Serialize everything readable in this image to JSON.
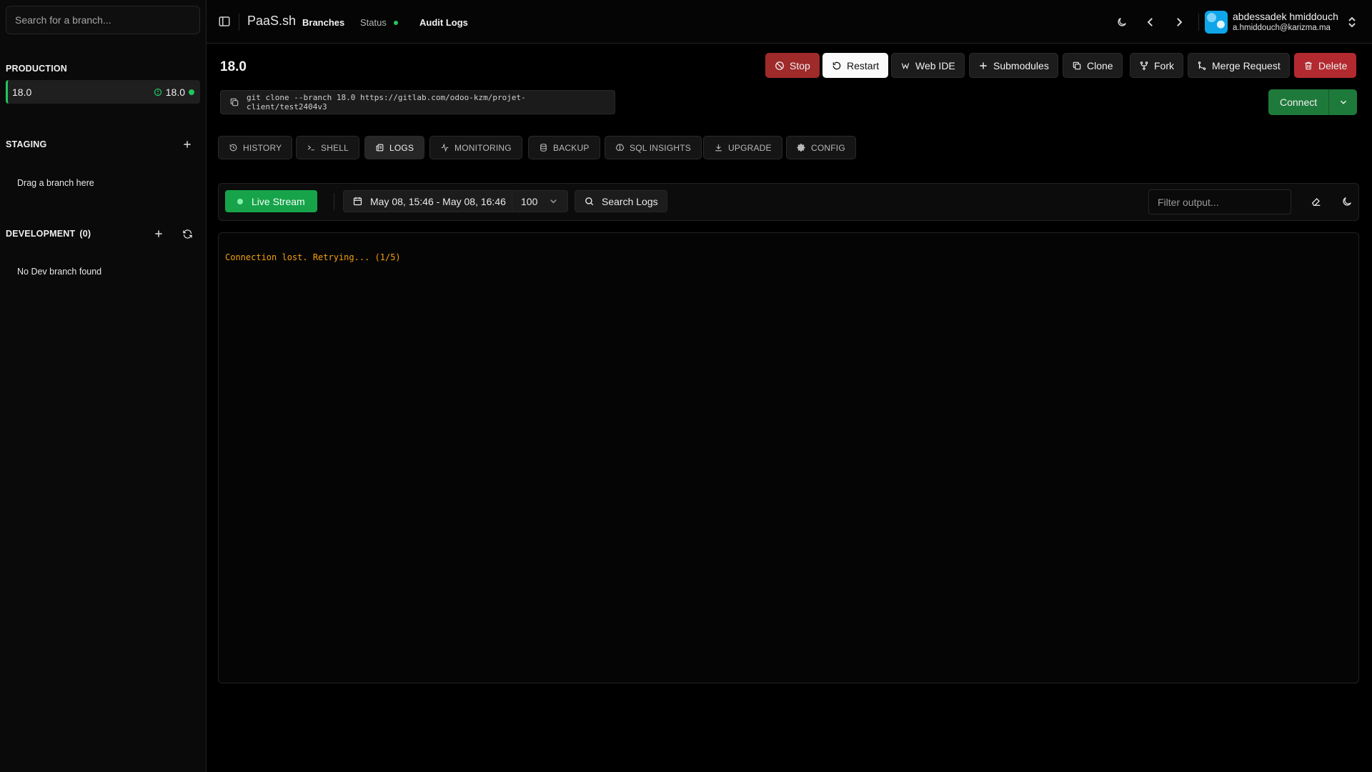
{
  "sidebar": {
    "search_placeholder": "Search for a branch...",
    "production": {
      "heading": "PRODUCTION",
      "branch_name": "18.0",
      "branch_version": "18.0"
    },
    "staging": {
      "heading": "STAGING",
      "empty_text": "Drag a branch here"
    },
    "development": {
      "heading": "DEVELOPMENT",
      "count": "(0)",
      "empty_text": "No Dev branch found"
    }
  },
  "topbar": {
    "brand": "PaaS.sh",
    "nav": {
      "branches": "Branches",
      "status": "Status",
      "audit_logs": "Audit Logs"
    },
    "user": {
      "name": "abdessadek hmiddouch",
      "email": "a.hmiddouch@karizma.ma"
    }
  },
  "main": {
    "branch_title": "18.0",
    "actions": {
      "stop": "Stop",
      "restart": "Restart",
      "web_ide": "Web IDE",
      "submodules": "Submodules",
      "clone": "Clone",
      "fork": "Fork",
      "merge_request": "Merge Request",
      "delete": "Delete"
    },
    "clone_command": "git clone --branch 18.0 https://gitlab.com/odoo-kzm/projet-client/test2404v3",
    "connect_label": "Connect",
    "tabs": {
      "history": "HISTORY",
      "shell": "SHELL",
      "logs": "LOGS",
      "monitoring": "MONITORING",
      "backup": "BACKUP",
      "sql_insights": "SQL INSIGHTS",
      "upgrade": "UPGRADE",
      "config": "CONFIG"
    },
    "logs": {
      "live_stream": "Live Stream",
      "date_range": "May 08, 15:46 - May 08, 16:46",
      "line_count": "100",
      "search_logs": "Search Logs",
      "filter_placeholder": "Filter output...",
      "lines": [
        "Connection lost. Retrying... (1/5)"
      ]
    }
  },
  "colors": {
    "accent_green": "#16a34a",
    "status_green": "#22c55e",
    "danger_red": "#b22a2f",
    "warning_text": "#f59e0b"
  }
}
